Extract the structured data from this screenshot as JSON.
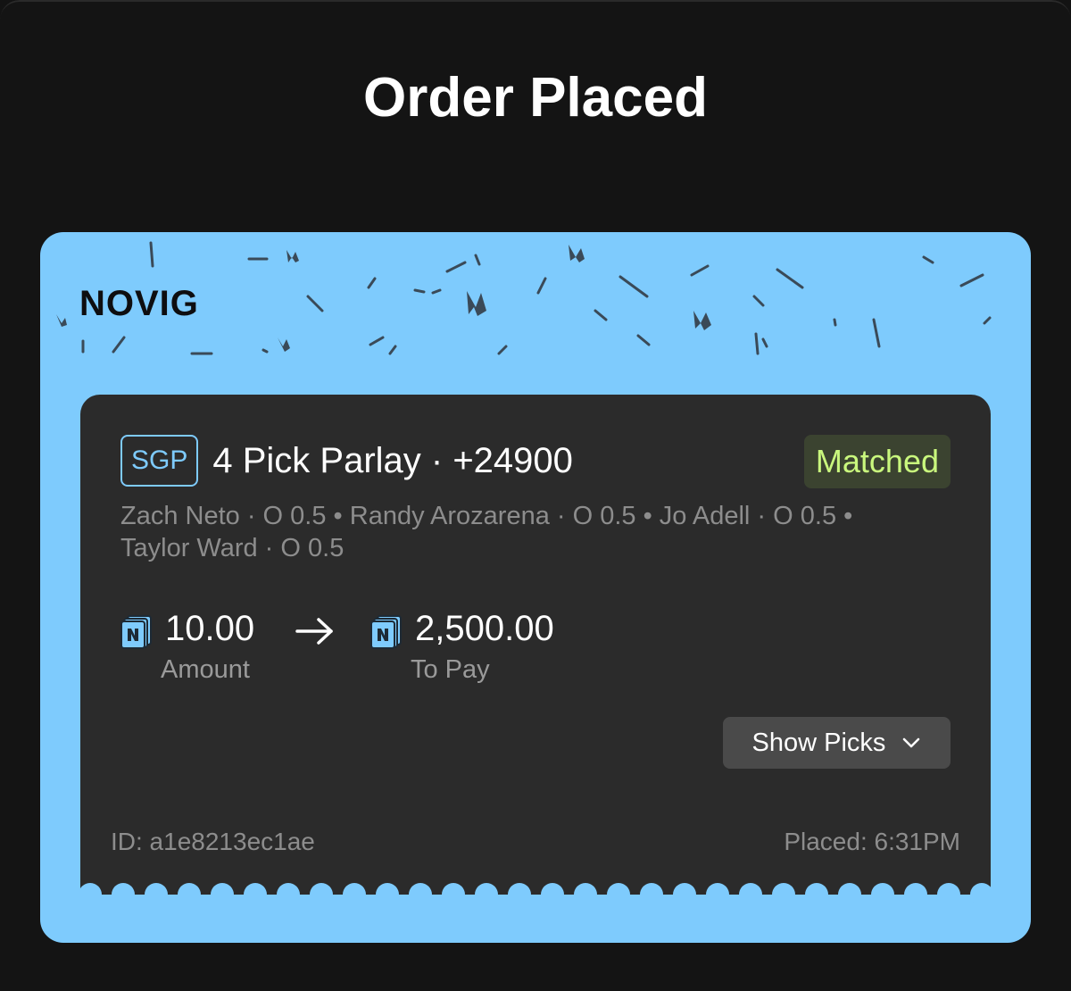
{
  "page": {
    "title": "Order Placed"
  },
  "brand": {
    "logo_text": "NOVIG",
    "ticket_color": "#7ecbfd",
    "card_color": "#2b2b2b"
  },
  "bet": {
    "badge": "SGP",
    "title": "4 Pick Parlay · +24900",
    "status": "Matched",
    "status_color": "#c9f77d",
    "picks_summary": "Zach Neto · O 0.5 • Randy Arozarena · O 0.5 • Jo Adell · O 0.5 • Taylor Ward · O 0.5",
    "amount": {
      "value": "10.00",
      "label": "Amount",
      "icon": "novig-coin-icon"
    },
    "payout": {
      "value": "2,500.00",
      "label": "To Pay",
      "icon": "novig-coin-icon"
    },
    "arrow_icon": "arrow-right-icon",
    "show_picks_label": "Show Picks",
    "show_picks_icon": "chevron-down-icon",
    "id_text": "ID: a1e8213ec1ae",
    "placed_text": "Placed: 6:31PM"
  }
}
